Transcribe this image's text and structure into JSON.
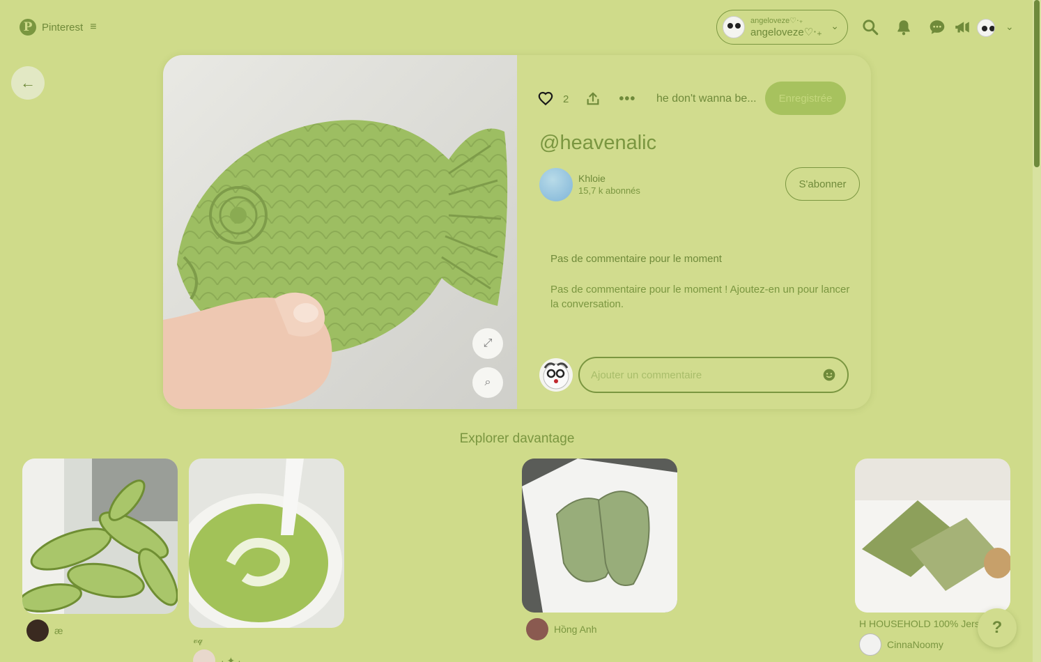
{
  "app": {
    "brand": "Pinterest"
  },
  "account": {
    "small_name": "angeloveze♡‧₊",
    "display_name": "angeloveze♡‧₊"
  },
  "pin": {
    "like_count": "2",
    "board_name": "he don't wanna be...",
    "save_label": "Enregistrée",
    "title": "@heavenalic",
    "creator_name": "Khloie",
    "creator_followers": "15,7 k abonnés",
    "follow_label": "S'abonner",
    "comments_heading": "Pas de commentaire pour le moment",
    "comments_empty_text": "Pas de commentaire pour le moment ! Ajoutez-en un pour lancer la conversation.",
    "comment_placeholder": "Ajouter un commentaire"
  },
  "explore": {
    "title": "Explorer davantage",
    "pins": [
      {
        "author": "æ"
      },
      {
        "caption": "𝓋𝓆",
        "author": "· ✦ ·"
      },
      {
        "author": "Hồng Anh"
      },
      {
        "caption": "H HOUSEHOLD 100% Jerse",
        "author": "CinnaNoomy"
      }
    ]
  },
  "help_label": "?",
  "colors": {
    "background": "#cfdb8a",
    "accent": "#7a9640",
    "save_button": "#a7c25e"
  }
}
